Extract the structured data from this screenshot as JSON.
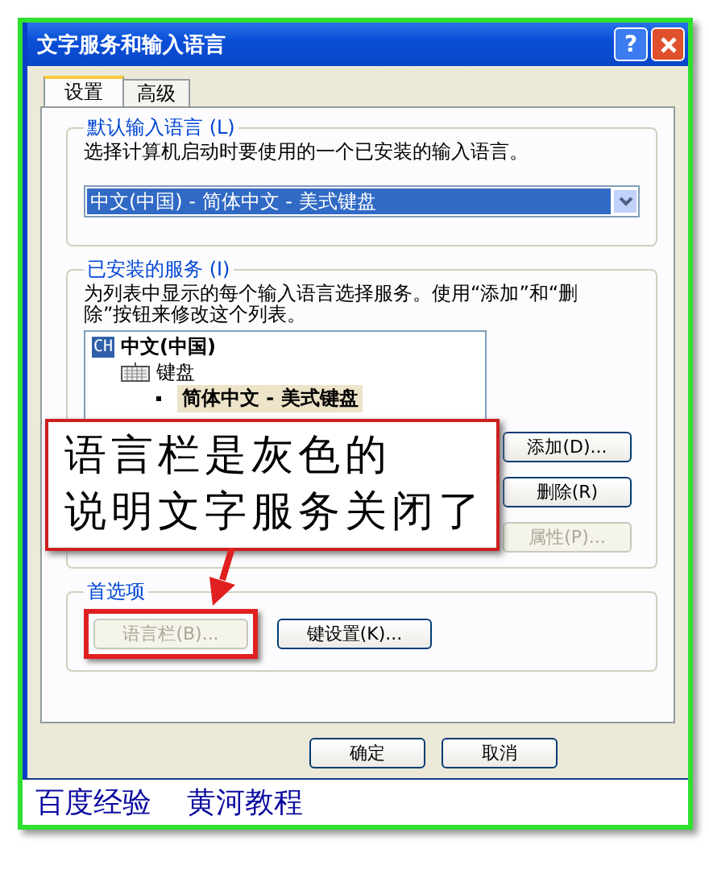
{
  "window": {
    "title": "文字服务和输入语言",
    "help": "?"
  },
  "tabs": [
    {
      "label": "设置",
      "selected": true
    },
    {
      "label": "高级",
      "selected": false
    }
  ],
  "default_language": {
    "legend": "默认输入语言 (L)",
    "description": "选择计算机启动时要使用的一个已安装的输入语言。",
    "dropdown": {
      "value": "中文(中国) - 简体中文 - 美式键盘"
    }
  },
  "installed_services": {
    "legend": "已安装的服务 (I)",
    "description": "为列表中显示的每个输入语言选择服务。使用“添加”和“删除”按钮来修改这个列表。",
    "tree": [
      {
        "badge": "CH",
        "label": "中文(中国)",
        "children": [
          {
            "label": "键盘",
            "children": [
              {
                "label": "简体中文 - 美式键盘",
                "selected": true
              }
            ]
          }
        ]
      }
    ],
    "buttons": [
      {
        "label": "添加(D)...",
        "disabled": false
      },
      {
        "label": "删除(R)",
        "disabled": false
      },
      {
        "label": "属性(P)...",
        "disabled": true
      }
    ]
  },
  "preferences": {
    "legend": "首选项",
    "buttons": [
      {
        "label": "语言栏(B)...",
        "disabled": true,
        "highlighted": true
      },
      {
        "label": "键设置(K)...",
        "disabled": false,
        "highlighted": false
      }
    ]
  },
  "footer_buttons": [
    {
      "label": "确定",
      "disabled": false
    },
    {
      "label": "取消",
      "disabled": false
    }
  ],
  "callout": {
    "lines": [
      "语言栏是灰色的",
      "说明文字服务关闭了"
    ]
  },
  "caption": [
    "百度经验",
    "黄河教程"
  ]
}
